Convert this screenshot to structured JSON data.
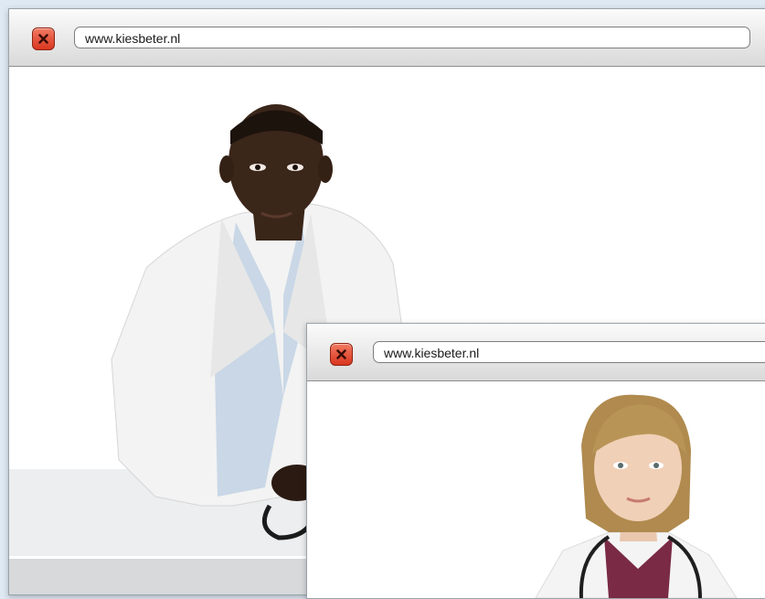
{
  "windows": [
    {
      "url": "www.kiesbeter.nl",
      "photo": "male-doctor-photo"
    },
    {
      "url": "www.kiesbeter.nl",
      "photo": "female-doctor-photo"
    }
  ],
  "icons": {
    "close": "close-icon"
  },
  "colors": {
    "close_button": "#e0452d",
    "titlebar_top": "#fbfbfb",
    "titlebar_bottom": "#d9d9d9",
    "lab_coat": "#f4f4f4",
    "desktop": "#dfe9f3"
  }
}
